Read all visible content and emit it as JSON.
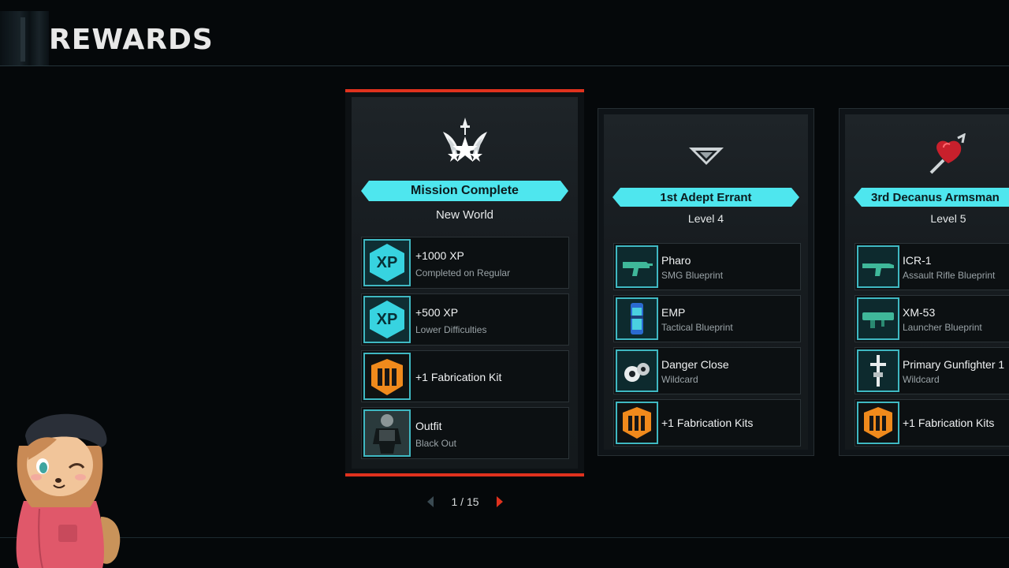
{
  "header": {
    "title": "REWARDS"
  },
  "cards": [
    {
      "banner": "Mission Complete",
      "subtitle": "New World",
      "icon": "winged-skull-emblem-icon",
      "rewards": [
        {
          "title": "+1000 XP",
          "sub": "Completed on Regular",
          "icon": "xp-icon",
          "icon_text": "XP"
        },
        {
          "title": "+500 XP",
          "sub": "Lower Difficulties",
          "icon": "xp-icon",
          "icon_text": "XP"
        },
        {
          "title": "+1 Fabrication Kit",
          "sub": "",
          "icon": "fabrication-kit-icon"
        },
        {
          "title": "Outfit",
          "sub": "Black Out",
          "icon": "outfit-icon"
        }
      ]
    },
    {
      "banner": "1st Adept Errant",
      "subtitle": "Level 4",
      "icon": "chevron-rank-icon",
      "rewards": [
        {
          "title": "Pharo",
          "sub": "SMG Blueprint",
          "icon": "smg-icon"
        },
        {
          "title": "EMP",
          "sub": "Tactical Blueprint",
          "icon": "emp-grenade-icon"
        },
        {
          "title": "Danger Close",
          "sub": "Wildcard",
          "icon": "danger-close-icon"
        },
        {
          "title": "+1 Fabrication Kits",
          "sub": "",
          "icon": "fabrication-kit-icon"
        }
      ]
    },
    {
      "banner": "3rd Decanus Armsman",
      "subtitle": "Level 5",
      "icon": "red-heart-dagger-icon",
      "rewards": [
        {
          "title": "ICR-1",
          "sub": "Assault Rifle Blueprint",
          "icon": "assault-rifle-icon"
        },
        {
          "title": "XM-53",
          "sub": "Launcher Blueprint",
          "icon": "launcher-icon"
        },
        {
          "title": "Primary Gunfighter 1",
          "sub": "Wildcard",
          "icon": "gunfighter-icon"
        },
        {
          "title": "+1 Fabrication Kits",
          "sub": "",
          "icon": "fabrication-kit-icon"
        }
      ]
    }
  ],
  "pager": {
    "current": "1",
    "total": "15",
    "label": "1 / 15"
  },
  "colors": {
    "accent_cyan": "#4ee6ee",
    "accent_red": "#e0321e",
    "fab_orange": "#f08a1c"
  }
}
